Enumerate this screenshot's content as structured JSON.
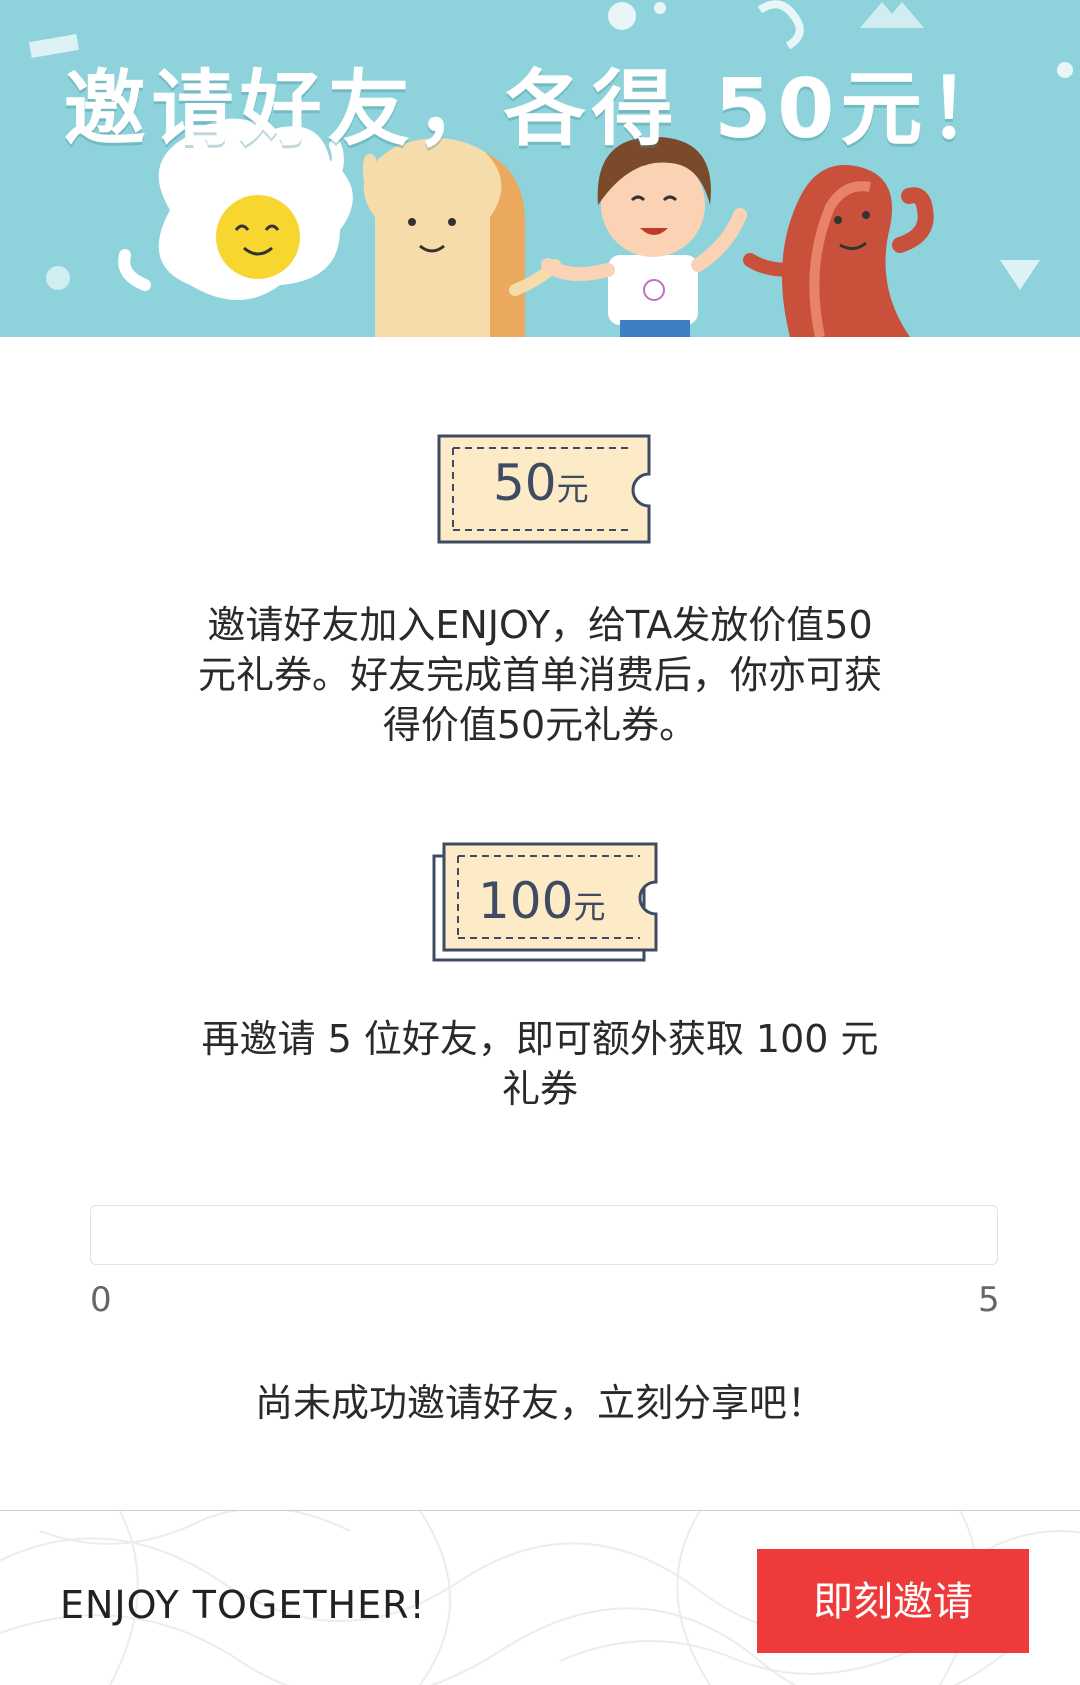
{
  "banner": {
    "title": "邀请好友，各得 50元！",
    "background_color": "#8ed3dc"
  },
  "coupon_single": {
    "amount": "50",
    "unit": "元"
  },
  "description_1": {
    "line1": "邀请好友加入ENJOY，给TA发放价值50",
    "line2": "元礼券。好友完成首单消费后，你亦可获",
    "line3": "得价值50元礼券。"
  },
  "coupon_stack": {
    "amount": "100",
    "unit": "元"
  },
  "description_2": {
    "line1": "再邀请 5 位好友，即可额外获取 100 元",
    "line2": "礼券"
  },
  "progress": {
    "min_label": "0",
    "max_label": "5",
    "current": 0,
    "max": 5
  },
  "status_text": "尚未成功邀请好友，立刻分享吧！",
  "footer": {
    "slogan": "ENJOY TOGETHER!",
    "invite_button": "即刻邀请"
  },
  "colors": {
    "accent": "#ee3a3a",
    "coupon_fill": "#fcebc6",
    "coupon_stroke": "#3f4a63"
  },
  "icons": [
    "egg-character-icon",
    "toast-character-icon",
    "boy-character-icon",
    "bacon-character-icon",
    "coupon-icon",
    "coupon-stack-icon"
  ]
}
